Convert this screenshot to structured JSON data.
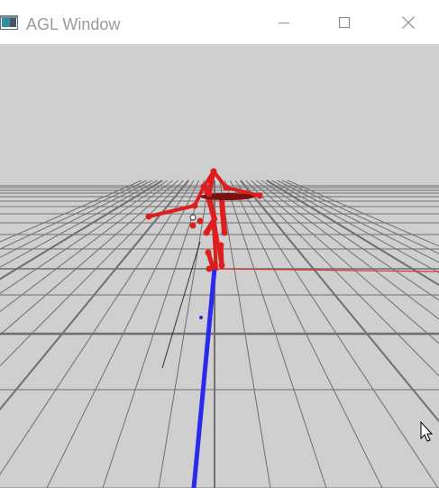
{
  "window": {
    "title": "AGL Window",
    "controls": {
      "minimize": "minimize-icon",
      "maximize": "maximize-icon",
      "close": "close-icon"
    }
  },
  "scene": {
    "background_color": "#cfcfcf",
    "floor_grid_color": "#6f6f6f",
    "skeleton_color": "#dd1e1e",
    "axis_colors": {
      "x": "#e03030",
      "z": "#2a2aee",
      "y": "#303030"
    },
    "icons": [
      "app-icon",
      "mouse-cursor-icon"
    ]
  }
}
